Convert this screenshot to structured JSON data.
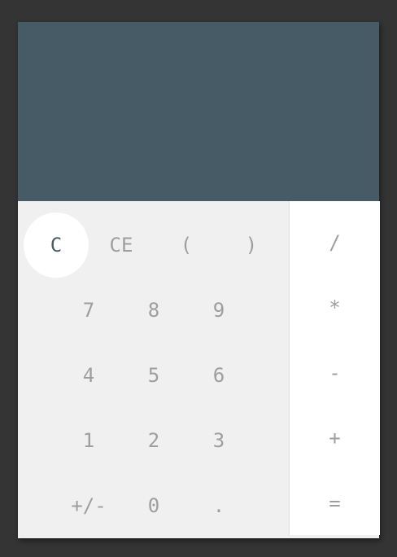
{
  "display": {
    "value": ""
  },
  "keypad": {
    "row1": [
      "C",
      "CE",
      "(",
      ")"
    ],
    "row2": [
      "7",
      "8",
      "9"
    ],
    "row3": [
      "4",
      "5",
      "6"
    ],
    "row4": [
      "1",
      "2",
      "3"
    ],
    "row5": [
      "+/-",
      "0",
      "."
    ]
  },
  "operators": [
    "/",
    "*",
    "-",
    "+",
    "="
  ],
  "colors": {
    "display_background": "#475b66",
    "keypad_background": "#f0f0f0",
    "operator_background": "#ffffff",
    "key_text": "#9e9e9e",
    "active_key_text": "#475b66"
  }
}
